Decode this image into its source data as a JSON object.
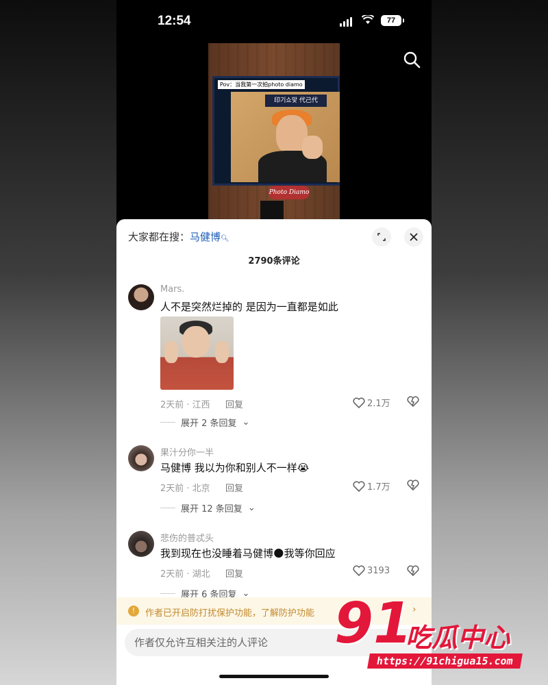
{
  "status_bar": {
    "time": "12:54",
    "battery": "77"
  },
  "video": {
    "caption": "Pov：当我第一次拍photo diamo",
    "screen_banner": "印기쇼맞 代己代",
    "logo": "Photo Diamo"
  },
  "panel": {
    "hot_search_label": "大家都在搜：",
    "hot_search_keyword": "马健博",
    "comment_count": "2790条评论"
  },
  "comments": [
    {
      "user": "Mars.",
      "text": "人不是突然烂掉的 是因为一直都是如此",
      "meta": "2天前 · 江西",
      "reply": "回复",
      "likes": "2.1万",
      "expand": "展开 2 条回复"
    },
    {
      "user": "果汁分你一半",
      "text": "马健博 我以为你和别人不一样😭",
      "meta": "2天前 · 北京",
      "reply": "回复",
      "likes": "1.7万",
      "expand": "展开 12 条回复"
    },
    {
      "user": "悲伤的普忒头",
      "text": "我到现在也没睡着马健博🌑我等你回应",
      "meta": "2天前 · 湖北",
      "reply": "回复",
      "likes": "3193",
      "expand": "展开 6 条回复"
    }
  ],
  "warning": {
    "text": "作者已开启防打扰保护功能，了解防护功能"
  },
  "input": {
    "placeholder": "作者仅允许互相关注的人评论"
  },
  "watermark": {
    "number": "91",
    "title": "吃瓜中心",
    "url": "https://91chigua15.com"
  },
  "icons": {
    "search": "search-icon",
    "expand": "expand-icon",
    "close": "close-icon",
    "like": "heart-icon",
    "dislike": "broken-heart-icon",
    "warning": "warning-icon"
  },
  "colors": {
    "link": "#1f5fb8",
    "warning_bg": "#fdf7e7",
    "warning_text": "#c28a2e",
    "watermark": "#e3173a"
  }
}
